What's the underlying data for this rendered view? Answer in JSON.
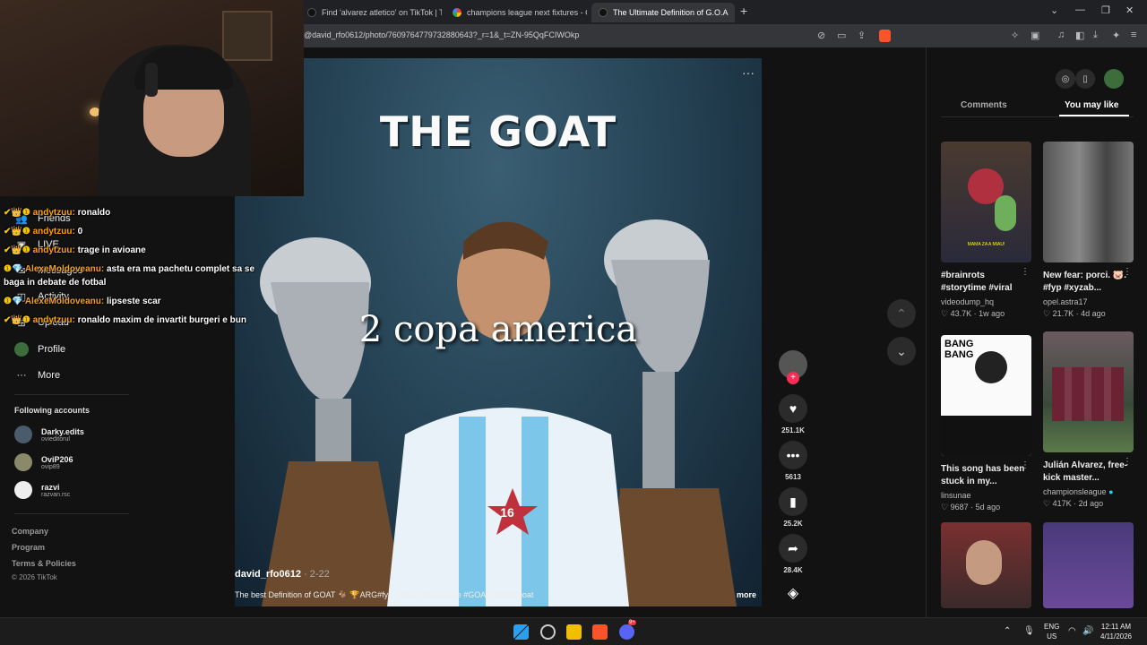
{
  "browser": {
    "tabs": [
      {
        "title": "Find 'alvarez atletico' on TikTok | TikT"
      },
      {
        "title": "champions league next fixtures - Goo"
      },
      {
        "title": "The Ultimate Definition of G.O.A"
      }
    ],
    "url": "@david_rfo0612/photo/7609764779732880643?_r=1&_t=ZN-95QqFCIWOkp",
    "new_tab_glyph": "+"
  },
  "sidebar": {
    "nav": [
      {
        "label": "Friends"
      },
      {
        "label": "LIVE"
      },
      {
        "label": "Messages"
      },
      {
        "label": "Activity"
      },
      {
        "label": "Upload"
      },
      {
        "label": "Profile"
      },
      {
        "label": "More"
      }
    ],
    "following_header": "Following accounts",
    "accounts": [
      {
        "name": "Darky.edits",
        "handle": "ovieditorul"
      },
      {
        "name": "OviP206",
        "handle": "ovip89"
      },
      {
        "name": "razvi",
        "handle": "razvan.rsc"
      }
    ],
    "footer": [
      "Company",
      "Program",
      "Terms & Policies",
      "© 2026 TikTok"
    ]
  },
  "chat": [
    {
      "user": "andytzuu:",
      "msg": "ronaldo"
    },
    {
      "user": "andytzuu:",
      "msg": "0"
    },
    {
      "user": "andytzuu:",
      "msg": "trage in avioane"
    },
    {
      "user": "AlexeMoldoveanu:",
      "msg": "asta era ma pachetu complet sa se"
    },
    {
      "user": "",
      "msg": "baga  in debate de fotbal"
    },
    {
      "user": "AlexeMoldoveanu:",
      "msg": "lipseste scar"
    },
    {
      "user": "andytzuu:",
      "msg": "ronaldo maxim de invartit burgeri e bun"
    }
  ],
  "video": {
    "title_text": "THE GOAT",
    "caption": "2 copa america",
    "author": "david_rfo0612",
    "date": "2-22",
    "description": "The best Definition of GOAT 🐐 🏆ARG#fyp #viral #foryoupage #GOAT #messigoat",
    "more": "more",
    "jersey_number": "16"
  },
  "actions": {
    "likes": "251.1K",
    "comments": "5613",
    "saves": "25.2K",
    "shares": "28.4K"
  },
  "right_panel": {
    "tabs": [
      "Comments",
      "You may like"
    ],
    "active_tab": "You may like",
    "cards": [
      {
        "title": "#brainrots #storytime #viral",
        "user": "videodump_hq",
        "likes": "43.7K",
        "age": "1w ago"
      },
      {
        "title": "New fear: porci. 🐷. #fyp #xyzab...",
        "user": "opel.astra17",
        "likes": "21.7K",
        "age": "4d ago"
      },
      {
        "title": "This song has been stuck in my...",
        "user": "linsunae",
        "likes": "9687",
        "age": "5d ago"
      },
      {
        "title": "Julián Alvarez, free-kick master...",
        "user": "championsleague",
        "likes": "417K",
        "age": "2d ago"
      }
    ],
    "thumb_text": {
      "brainrot": "MAMA ZA A MIAU!",
      "bang": "BANG BANG"
    }
  },
  "taskbar": {
    "lang_top": "ENG",
    "lang_bottom": "US",
    "time": "12:11 AM",
    "date": "4/11/2026",
    "discord_badge": "9+"
  },
  "colors": {
    "tiktok_red": "#fe2c55",
    "chat_user": "#ffa500",
    "verified": "#20d5ec"
  }
}
